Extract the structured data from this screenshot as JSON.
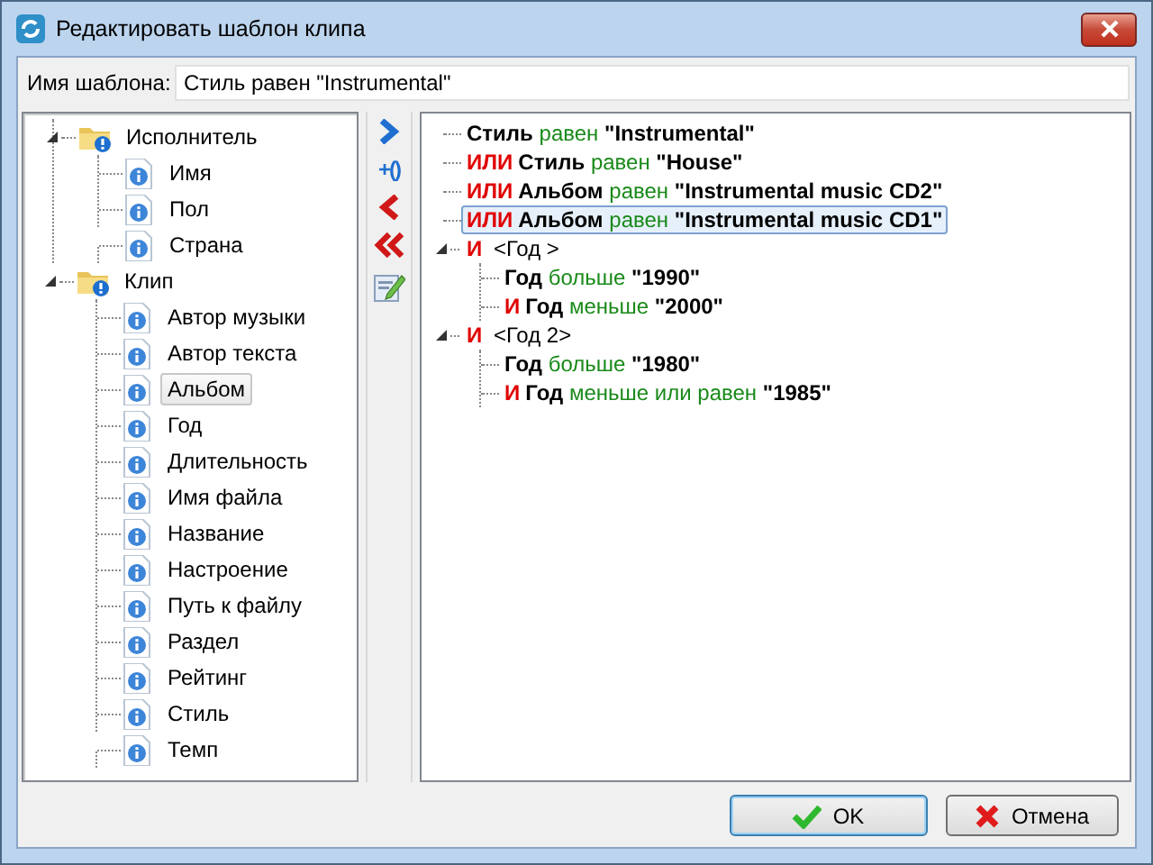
{
  "window": {
    "title": "Редактировать шаблон клипа"
  },
  "template_name": {
    "label": "Имя шаблона:",
    "value": "Стиль равен \"Instrumental\""
  },
  "fields": [
    {
      "label": "Исполнитель",
      "expanded": true,
      "children": [
        {
          "label": "Имя",
          "selected": false
        },
        {
          "label": "Пол",
          "selected": false
        },
        {
          "label": "Страна",
          "selected": false
        }
      ]
    },
    {
      "label": "Клип",
      "expanded": true,
      "children": [
        {
          "label": "Автор музыки",
          "selected": false
        },
        {
          "label": "Автор текста",
          "selected": false
        },
        {
          "label": "Альбом",
          "selected": true
        },
        {
          "label": "Год",
          "selected": false
        },
        {
          "label": "Длительность",
          "selected": false
        },
        {
          "label": "Имя файла",
          "selected": false
        },
        {
          "label": "Название",
          "selected": false
        },
        {
          "label": "Настроение",
          "selected": false
        },
        {
          "label": "Путь к файлу",
          "selected": false
        },
        {
          "label": "Раздел",
          "selected": false
        },
        {
          "label": "Рейтинг",
          "selected": false
        },
        {
          "label": "Стиль",
          "selected": false
        },
        {
          "label": "Темп",
          "selected": false
        }
      ]
    }
  ],
  "toolbar": [
    {
      "kind": "add"
    },
    {
      "kind": "add-group",
      "label": "+()"
    },
    {
      "kind": "remove"
    },
    {
      "kind": "remove-all"
    },
    {
      "kind": "edit"
    }
  ],
  "conditions": [
    {
      "kind": "condition",
      "field": "Стиль",
      "comparator": "равен",
      "value": "\"Instrumental\"",
      "selected": false
    },
    {
      "kind": "condition",
      "op": "ИЛИ",
      "field": "Стиль",
      "comparator": "равен",
      "value": "\"House\"",
      "selected": false
    },
    {
      "kind": "condition",
      "op": "ИЛИ",
      "field": "Альбом",
      "comparator": "равен",
      "value": "\"Instrumental music CD2\"",
      "selected": false
    },
    {
      "kind": "condition",
      "op": "ИЛИ",
      "field": "Альбом",
      "comparator": "равен",
      "value": "\"Instrumental music CD1\"",
      "selected": true
    },
    {
      "kind": "group",
      "op": "И",
      "label": "<Год >",
      "expanded": true,
      "children": [
        {
          "field": "Год",
          "comparator": "больше",
          "value": "\"1990\"",
          "selected": false
        },
        {
          "op": "И",
          "field": "Год",
          "comparator": "меньше",
          "value": "\"2000\"",
          "selected": false
        }
      ]
    },
    {
      "kind": "group",
      "op": "И",
      "label": "<Год 2>",
      "expanded": true,
      "children": [
        {
          "field": "Год",
          "comparator": "больше",
          "value": "\"1980\"",
          "selected": false
        },
        {
          "op": "И",
          "field": "Год",
          "comparator": "меньше или равен",
          "value": "\"1985\"",
          "selected": false
        }
      ]
    }
  ],
  "buttons": [
    {
      "kind": "ok",
      "label": "OK",
      "focused": true
    },
    {
      "kind": "cancel",
      "label": "Отмена",
      "focused": false
    }
  ]
}
